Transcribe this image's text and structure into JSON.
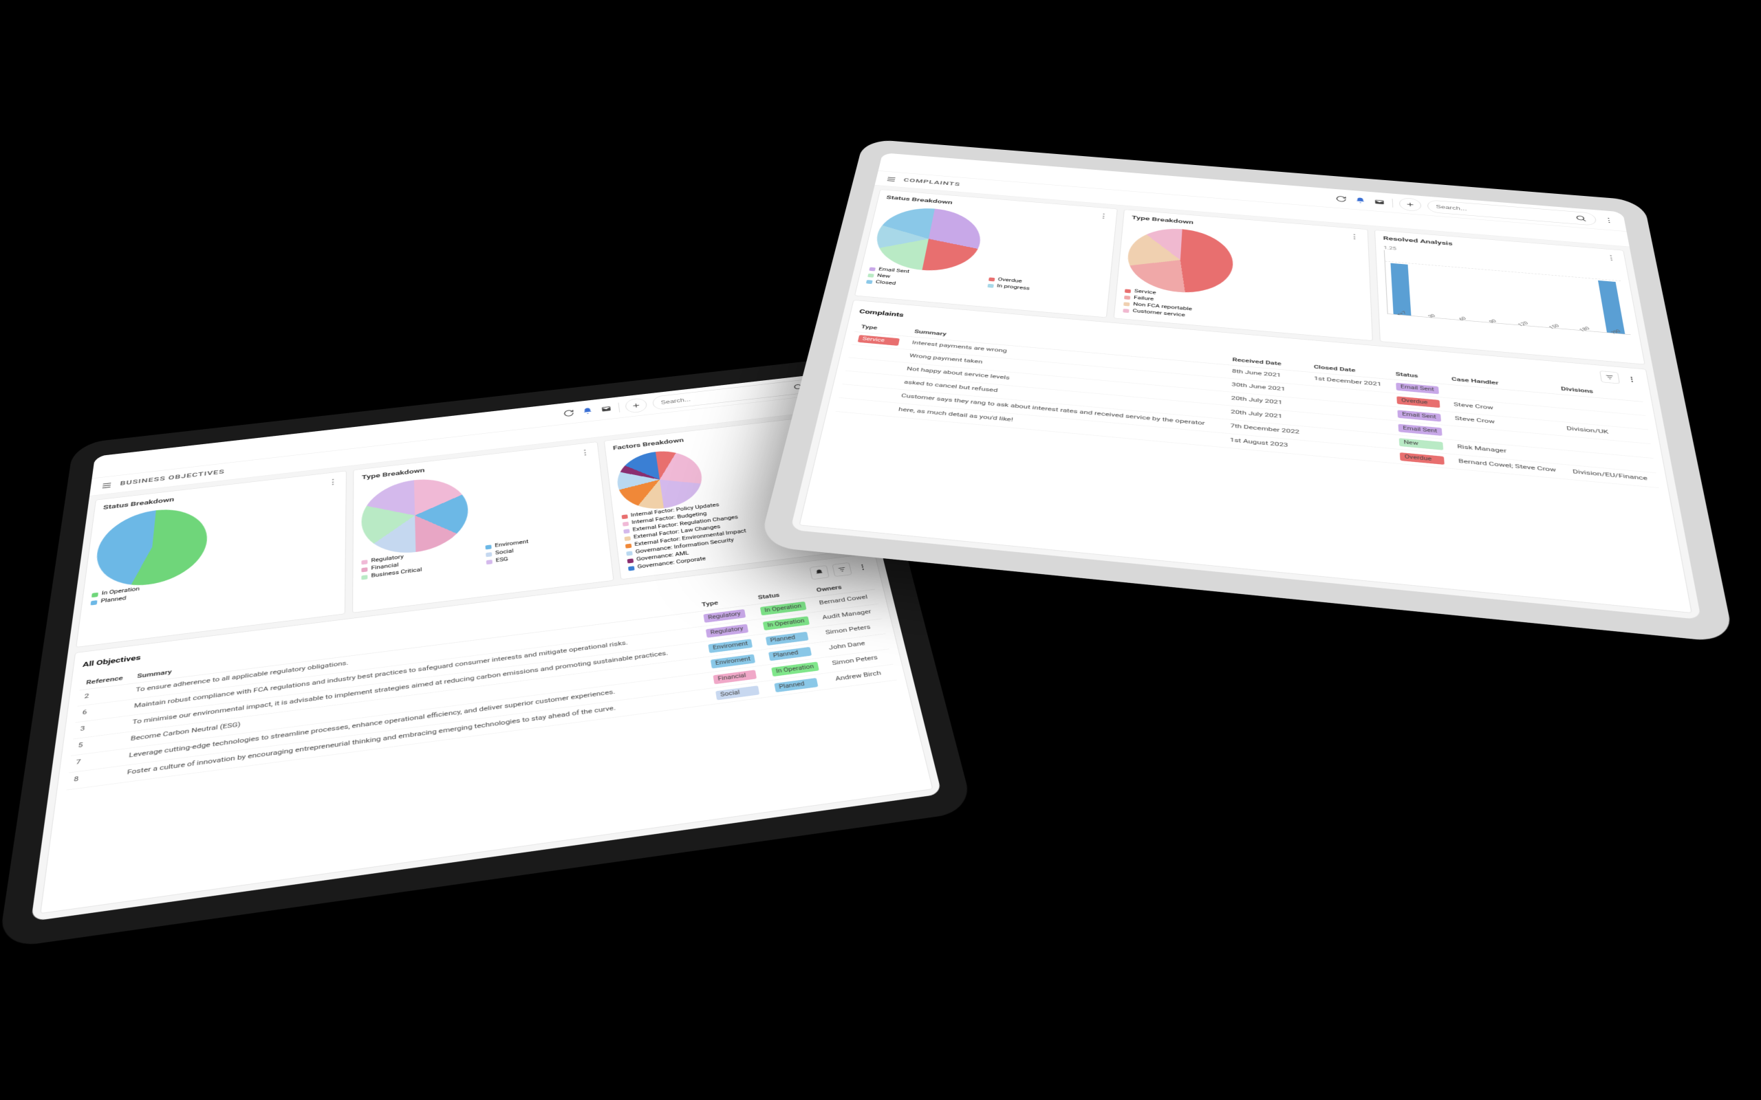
{
  "left_tablet": {
    "page_title": "BUSINESS OBJECTIVES",
    "search_placeholder": "Search...",
    "cards": {
      "status": {
        "title": "Status Breakdown"
      },
      "type": {
        "title": "Type Breakdown"
      },
      "factors": {
        "title": "Factors Breakdown"
      }
    },
    "status_legend": [
      {
        "label": "In Operation",
        "color": "#6fd67a"
      },
      {
        "label": "Planned",
        "color": "#6cb8e6"
      }
    ],
    "type_legend": [
      {
        "label": "Regulatory",
        "color": "#f0b9d6"
      },
      {
        "label": "Enviroment",
        "color": "#6cb8e6"
      },
      {
        "label": "Financial",
        "color": "#e8a6c5"
      },
      {
        "label": "Social",
        "color": "#c5d8f0"
      },
      {
        "label": "Business Critical",
        "color": "#b9eac5"
      },
      {
        "label": "ESG",
        "color": "#d4b9ec"
      }
    ],
    "factors_legend": [
      {
        "label": "Internal Factor: Policy Updates",
        "color": "#e86f6f"
      },
      {
        "label": "Internal Factor: Budgeting",
        "color": "#f0b9d6"
      },
      {
        "label": "External Factor: Regulation Changes",
        "color": "#d4b9ec"
      },
      {
        "label": "External Factor: Law Changes",
        "color": "#f0d0a8"
      },
      {
        "label": "External Factor: Environmental Impact",
        "color": "#f08838"
      },
      {
        "label": "Governance: Information Security",
        "color": "#b9d8f0"
      },
      {
        "label": "Governance: AML",
        "color": "#8a2e6f"
      },
      {
        "label": "Governance: Corporate",
        "color": "#3a7fd4"
      }
    ],
    "table": {
      "title": "All Objectives",
      "headers": [
        "Reference",
        "Summary",
        "Type",
        "Status",
        "Owners"
      ],
      "rows": [
        {
          "ref": "2",
          "summary": "To ensure adherence to all applicable regulatory obligations.",
          "type": "Regulatory",
          "type_color": "#c8a8e8",
          "status": "In Operation",
          "status_color": "#7fe68a",
          "owner": "Bernard Cowel"
        },
        {
          "ref": "6",
          "summary": "Maintain robust compliance with FCA regulations and industry best practices to safeguard consumer interests and mitigate operational risks.",
          "type": "Regulatory",
          "type_color": "#c8a8e8",
          "status": "In Operation",
          "status_color": "#7fe68a",
          "owner": "Audit Manager"
        },
        {
          "ref": "3",
          "summary": "To minimise our environmental impact, it is advisable to implement strategies aimed at reducing carbon emissions and promoting sustainable practices.",
          "type": "Enviroment",
          "type_color": "#8ac8e8",
          "status": "Planned",
          "status_color": "#8ac8e8",
          "owner": "Simon Peters"
        },
        {
          "ref": "5",
          "summary": "Become Carbon Neutral (ESG)",
          "type": "Enviroment",
          "type_color": "#8ac8e8",
          "status": "Planned",
          "status_color": "#8ac8e8",
          "owner": "John Dane"
        },
        {
          "ref": "7",
          "summary": "Leverage cutting-edge technologies to streamline processes, enhance operational efficiency, and deliver superior customer experiences.",
          "type": "Financial",
          "type_color": "#f0a8c8",
          "status": "In Operation",
          "status_color": "#7fe68a",
          "owner": "Simon Peters"
        },
        {
          "ref": "8",
          "summary": "Foster a culture of innovation by encouraging entrepreneurial thinking and embracing emerging technologies to stay ahead of the curve.",
          "type": "Social",
          "type_color": "#c8d8f0",
          "status": "Planned",
          "status_color": "#8ac8e8",
          "owner": "Andrew Birch"
        }
      ]
    }
  },
  "right_tablet": {
    "page_title": "COMPLAINTS",
    "search_placeholder": "Search...",
    "cards": {
      "status": {
        "title": "Status Breakdown"
      },
      "type": {
        "title": "Type Breakdown"
      },
      "resolved": {
        "title": "Resolved Analysis"
      }
    },
    "status_legend": [
      {
        "label": "Email Sent",
        "color": "#c8a8e8"
      },
      {
        "label": "Overdue",
        "color": "#e86f6f"
      },
      {
        "label": "New",
        "color": "#b9eac5"
      },
      {
        "label": "In progress",
        "color": "#a8d8e8"
      },
      {
        "label": "Closed",
        "color": "#8ac8e8"
      }
    ],
    "type_legend": [
      {
        "label": "Service",
        "color": "#e86f6f"
      },
      {
        "label": "Failure",
        "color": "#f0a8a8"
      },
      {
        "label": "Non FCA reportable",
        "color": "#f0d0b0"
      },
      {
        "label": "Customer service",
        "color": "#f0b9d0"
      }
    ],
    "resolved_ymax": "1.25",
    "resolved_x": [
      "<=7",
      "30",
      "60",
      "90",
      "120",
      "150",
      "180",
      "?90"
    ],
    "table": {
      "title": "Complaints",
      "headers": [
        "Type",
        "Summary",
        "Received Date",
        "Closed Date",
        "Status",
        "Case Handler",
        "Divisions"
      ],
      "rows": [
        {
          "type": "Service",
          "type_color": "#e86f6f",
          "summary": "Interest payments are wrong",
          "received": "8th June 2021",
          "closed": "1st December 2021",
          "status": "Email Sent",
          "status_color": "#c8a8e8",
          "handler": "",
          "division": ""
        },
        {
          "type": "",
          "type_color": "",
          "summary": "Wrong payment taken",
          "received": "30th June 2021",
          "closed": "",
          "status": "Overdue",
          "status_color": "#e86f6f",
          "handler": "Steve Crow",
          "division": ""
        },
        {
          "type": "",
          "type_color": "",
          "summary": "Not happy about service levels",
          "received": "20th July 2021",
          "closed": "",
          "status": "Email Sent",
          "status_color": "#c8a8e8",
          "handler": "Steve Crow",
          "division": "Division/UK"
        },
        {
          "type": "",
          "type_color": "",
          "summary": "asked to cancel but refused",
          "received": "20th July 2021",
          "closed": "",
          "status": "Email Sent",
          "status_color": "#c8a8e8",
          "handler": "",
          "division": ""
        },
        {
          "type": "",
          "type_color": "",
          "summary": "Customer says they rang to ask about interest rates and received service by the operator",
          "received": "7th December 2022",
          "closed": "",
          "status": "New",
          "status_color": "#b9eac5",
          "handler": "Risk Manager",
          "division": ""
        },
        {
          "type": "",
          "type_color": "",
          "summary": "here, as much detail as you'd like!",
          "received": "1st August 2023",
          "closed": "",
          "status": "Overdue",
          "status_color": "#e86f6f",
          "handler": "Bernard Cowel; Steve Crow",
          "division": "Division/EU/Finance"
        }
      ]
    }
  },
  "chart_data": [
    {
      "type": "pie",
      "title": "Status Breakdown",
      "series": [
        {
          "name": "In Operation",
          "value": 55,
          "color": "#6fd67a"
        },
        {
          "name": "Planned",
          "value": 45,
          "color": "#6cb8e6"
        }
      ]
    },
    {
      "type": "pie",
      "title": "Type Breakdown (Business Objectives)",
      "series": [
        {
          "name": "Regulatory",
          "value": 18,
          "color": "#f0b9d6"
        },
        {
          "name": "Enviroment",
          "value": 18,
          "color": "#6cb8e6"
        },
        {
          "name": "Financial",
          "value": 14,
          "color": "#e8a6c5"
        },
        {
          "name": "Social",
          "value": 14,
          "color": "#c5d8f0"
        },
        {
          "name": "Business Critical",
          "value": 18,
          "color": "#b9eac5"
        },
        {
          "name": "ESG",
          "value": 18,
          "color": "#d4b9ec"
        }
      ]
    },
    {
      "type": "pie",
      "title": "Factors Breakdown",
      "series": [
        {
          "name": "Internal Factor: Policy Updates",
          "value": 8,
          "color": "#e86f6f"
        },
        {
          "name": "Internal Factor: Budgeting",
          "value": 22,
          "color": "#f0b9d6"
        },
        {
          "name": "External Factor: Regulation Changes",
          "value": 20,
          "color": "#d4b9ec"
        },
        {
          "name": "External Factor: Law Changes",
          "value": 10,
          "color": "#f0d0a8"
        },
        {
          "name": "External Factor: Environmental Impact",
          "value": 12,
          "color": "#f08838"
        },
        {
          "name": "Governance: Information Security",
          "value": 10,
          "color": "#b9d8f0"
        },
        {
          "name": "Governance: AML",
          "value": 4,
          "color": "#8a2e6f"
        },
        {
          "name": "Governance: Corporate",
          "value": 14,
          "color": "#3a7fd4"
        }
      ]
    },
    {
      "type": "pie",
      "title": "Status Breakdown (Complaints)",
      "series": [
        {
          "name": "Email Sent",
          "value": 28,
          "color": "#c8a8e8"
        },
        {
          "name": "Overdue",
          "value": 22,
          "color": "#e86f6f"
        },
        {
          "name": "New",
          "value": 18,
          "color": "#b9eac5"
        },
        {
          "name": "In progress",
          "value": 12,
          "color": "#a8d8e8"
        },
        {
          "name": "Closed",
          "value": 20,
          "color": "#8ac8e8"
        }
      ]
    },
    {
      "type": "pie",
      "title": "Type Breakdown (Complaints)",
      "series": [
        {
          "name": "Service",
          "value": 48,
          "color": "#e86f6f"
        },
        {
          "name": "Failure",
          "value": 22,
          "color": "#f0a8a8"
        },
        {
          "name": "Non FCA reportable",
          "value": 18,
          "color": "#f0d0b0"
        },
        {
          "name": "Customer service",
          "value": 12,
          "color": "#f0b9d0"
        }
      ]
    },
    {
      "type": "bar",
      "title": "Resolved Analysis",
      "ylabel": "",
      "ylim": [
        0,
        1.25
      ],
      "categories": [
        "<=7",
        "30",
        "60",
        "90",
        "120",
        "150",
        "180",
        "?90"
      ],
      "values": [
        1,
        0,
        0,
        0,
        0,
        0,
        0,
        1
      ]
    }
  ]
}
